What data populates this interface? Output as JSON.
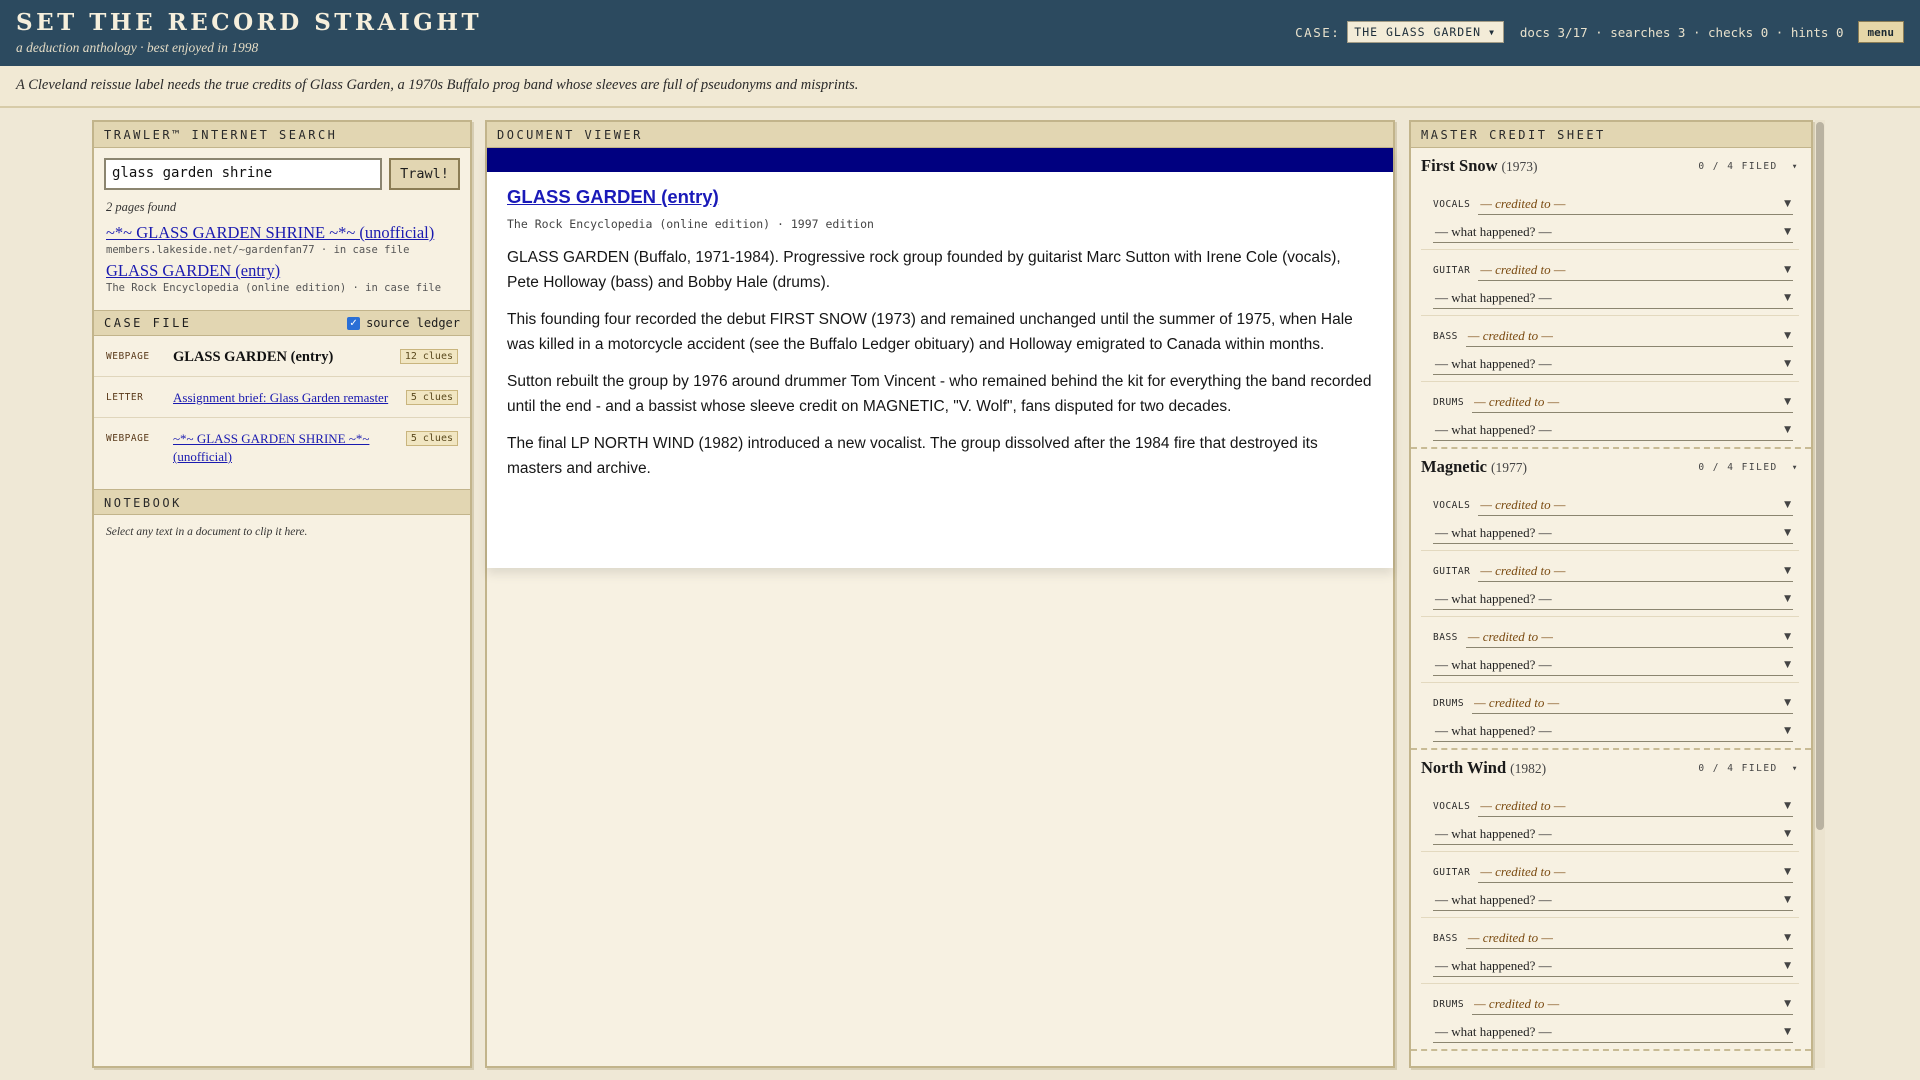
{
  "header": {
    "title": "SET THE RECORD STRAIGHT",
    "subtitle": "a deduction anthology · best enjoyed in 1998",
    "case_label": "CASE:",
    "case_value": "THE GLASS GARDEN",
    "stats": "docs 3/17 · searches 3 · checks 0 · hints 0",
    "menu_label": "menu"
  },
  "brief": "A Cleveland reissue label needs the true credits of Glass Garden, a 1970s Buffalo prog band whose sleeves are full of pseudonyms and misprints.",
  "search": {
    "panel_title": "TRAWLER™ INTERNET SEARCH",
    "query": "glass garden shrine",
    "button_label": "Trawl!",
    "found_text": "2 pages found",
    "results": [
      {
        "title": "~*~ GLASS GARDEN SHRINE ~*~ (unofficial)",
        "url": "members.lakeside.net/~gardenfan77 · in case file"
      },
      {
        "title": "GLASS GARDEN (entry)",
        "url": "The Rock Encyclopedia (online edition) · in case file"
      }
    ]
  },
  "case_file": {
    "title": "CASE FILE",
    "toggle_label": "source ledger",
    "items": [
      {
        "type": "WEBPAGE",
        "title": "GLASS GARDEN (entry)",
        "clues": "12 clues"
      },
      {
        "type": "LETTER",
        "title": "Assignment brief: Glass Garden remaster",
        "clues": "5 clues"
      },
      {
        "type": "WEBPAGE",
        "title": "~*~ GLASS GARDEN SHRINE ~*~ (unofficial)",
        "clues": "5 clues"
      }
    ]
  },
  "notebook": {
    "title": "NOTEBOOK",
    "placeholder": "Select any text in a document to clip it here."
  },
  "document": {
    "panel_title": "DOCUMENT VIEWER",
    "title": "GLASS GARDEN (entry)",
    "source": "The Rock Encyclopedia (online edition) · 1997 edition",
    "paragraphs": [
      "GLASS GARDEN (Buffalo, 1971-1984). Progressive rock group founded by guitarist Marc Sutton with Irene Cole (vocals), Pete Holloway (bass) and Bobby Hale (drums).",
      "This founding four recorded the debut FIRST SNOW (1973) and remained unchanged until the summer of 1975, when Hale was killed in a motorcycle accident (see the Buffalo Ledger obituary) and Holloway emigrated to Canada within months.",
      "Sutton rebuilt the group by 1976 around drummer Tom Vincent - who remained behind the kit for everything the band recorded until the end - and a bassist whose sleeve credit on MAGNETIC, \"V. Wolf\", fans disputed for two decades.",
      "The final LP NORTH WIND (1982) introduced a new vocalist. The group dissolved after the 1984 fire that destroyed its masters and archive."
    ]
  },
  "credits": {
    "panel_title": "MASTER CREDIT SHEET",
    "credit_placeholder": "— credited to —",
    "what_placeholder": "— what happened? —",
    "albums": [
      {
        "name": "First Snow",
        "year": "(1973)",
        "filed": "0 / 4 FILED",
        "roles": [
          "VOCALS",
          "GUITAR",
          "BASS",
          "DRUMS"
        ]
      },
      {
        "name": "Magnetic",
        "year": "(1977)",
        "filed": "0 / 4 FILED",
        "roles": [
          "VOCALS",
          "GUITAR",
          "BASS",
          "DRUMS"
        ]
      },
      {
        "name": "North Wind",
        "year": "(1982)",
        "filed": "0 / 4 FILED",
        "roles": [
          "VOCALS",
          "GUITAR",
          "BASS",
          "DRUMS"
        ]
      }
    ]
  }
}
